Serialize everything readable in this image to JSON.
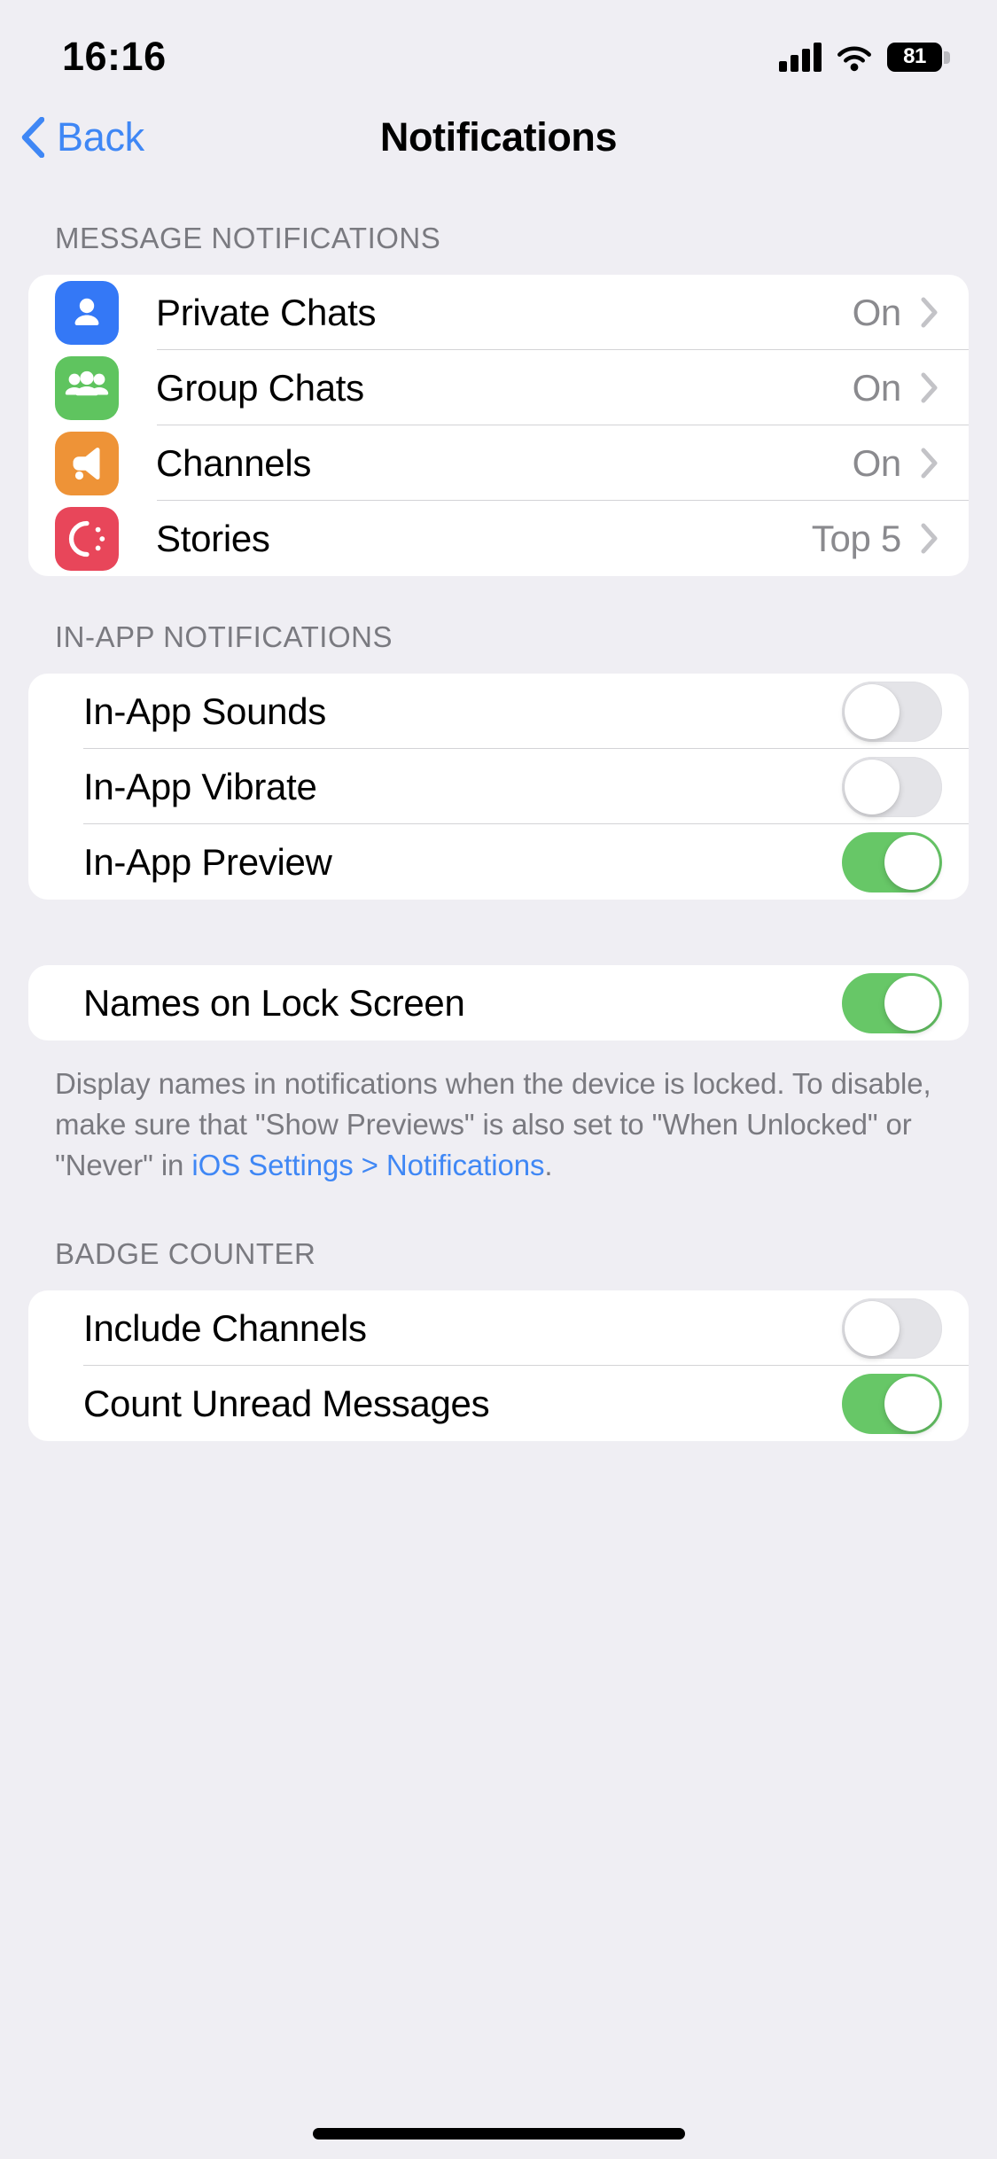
{
  "status_bar": {
    "time": "16:16",
    "battery_level": "81",
    "signal_icon": "cellular-signal-icon",
    "wifi_icon": "wifi-icon",
    "battery_icon": "battery-icon"
  },
  "nav": {
    "back_label": "Back",
    "back_icon": "chevron-left-icon",
    "title": "Notifications"
  },
  "sections": {
    "message_notifications": {
      "header": "MESSAGE NOTIFICATIONS",
      "rows": [
        {
          "label": "Private Chats",
          "value": "On",
          "icon": "person-icon",
          "icon_color": "#3478F6"
        },
        {
          "label": "Group Chats",
          "value": "On",
          "icon": "group-icon",
          "icon_color": "#5FC45F"
        },
        {
          "label": "Channels",
          "value": "On",
          "icon": "megaphone-icon",
          "icon_color": "#EE9337"
        },
        {
          "label": "Stories",
          "value": "Top 5",
          "icon": "stories-icon",
          "icon_color": "#E8465A"
        }
      ]
    },
    "in_app_notifications": {
      "header": "IN-APP NOTIFICATIONS",
      "rows": [
        {
          "label": "In-App Sounds",
          "state": "off"
        },
        {
          "label": "In-App Vibrate",
          "state": "off"
        },
        {
          "label": "In-App Preview",
          "state": "on"
        }
      ]
    },
    "names_on_lock_screen": {
      "rows": [
        {
          "label": "Names on Lock Screen",
          "state": "on"
        }
      ],
      "footnote": {
        "part1": "Display names in notifications when the device is locked. To disable, make sure that \"Show Previews\" is also set to \"When Unlocked\" or \"Never\" in ",
        "link": "iOS Settings > Notifications",
        "part2": "."
      }
    },
    "badge_counter": {
      "header": "BADGE COUNTER",
      "rows": [
        {
          "label": "Include Channels",
          "state": "off"
        },
        {
          "label": "Count Unread Messages",
          "state": "on"
        }
      ]
    }
  },
  "colors": {
    "page_background": "#EFEEF3",
    "card_background": "#FFFFFF",
    "accent_blue": "#3F87F5",
    "switch_on_green": "#67C767",
    "switch_off_gray": "#E4E4E8",
    "secondary_text": "#8A8A8E",
    "header_text": "#7A7A80"
  }
}
